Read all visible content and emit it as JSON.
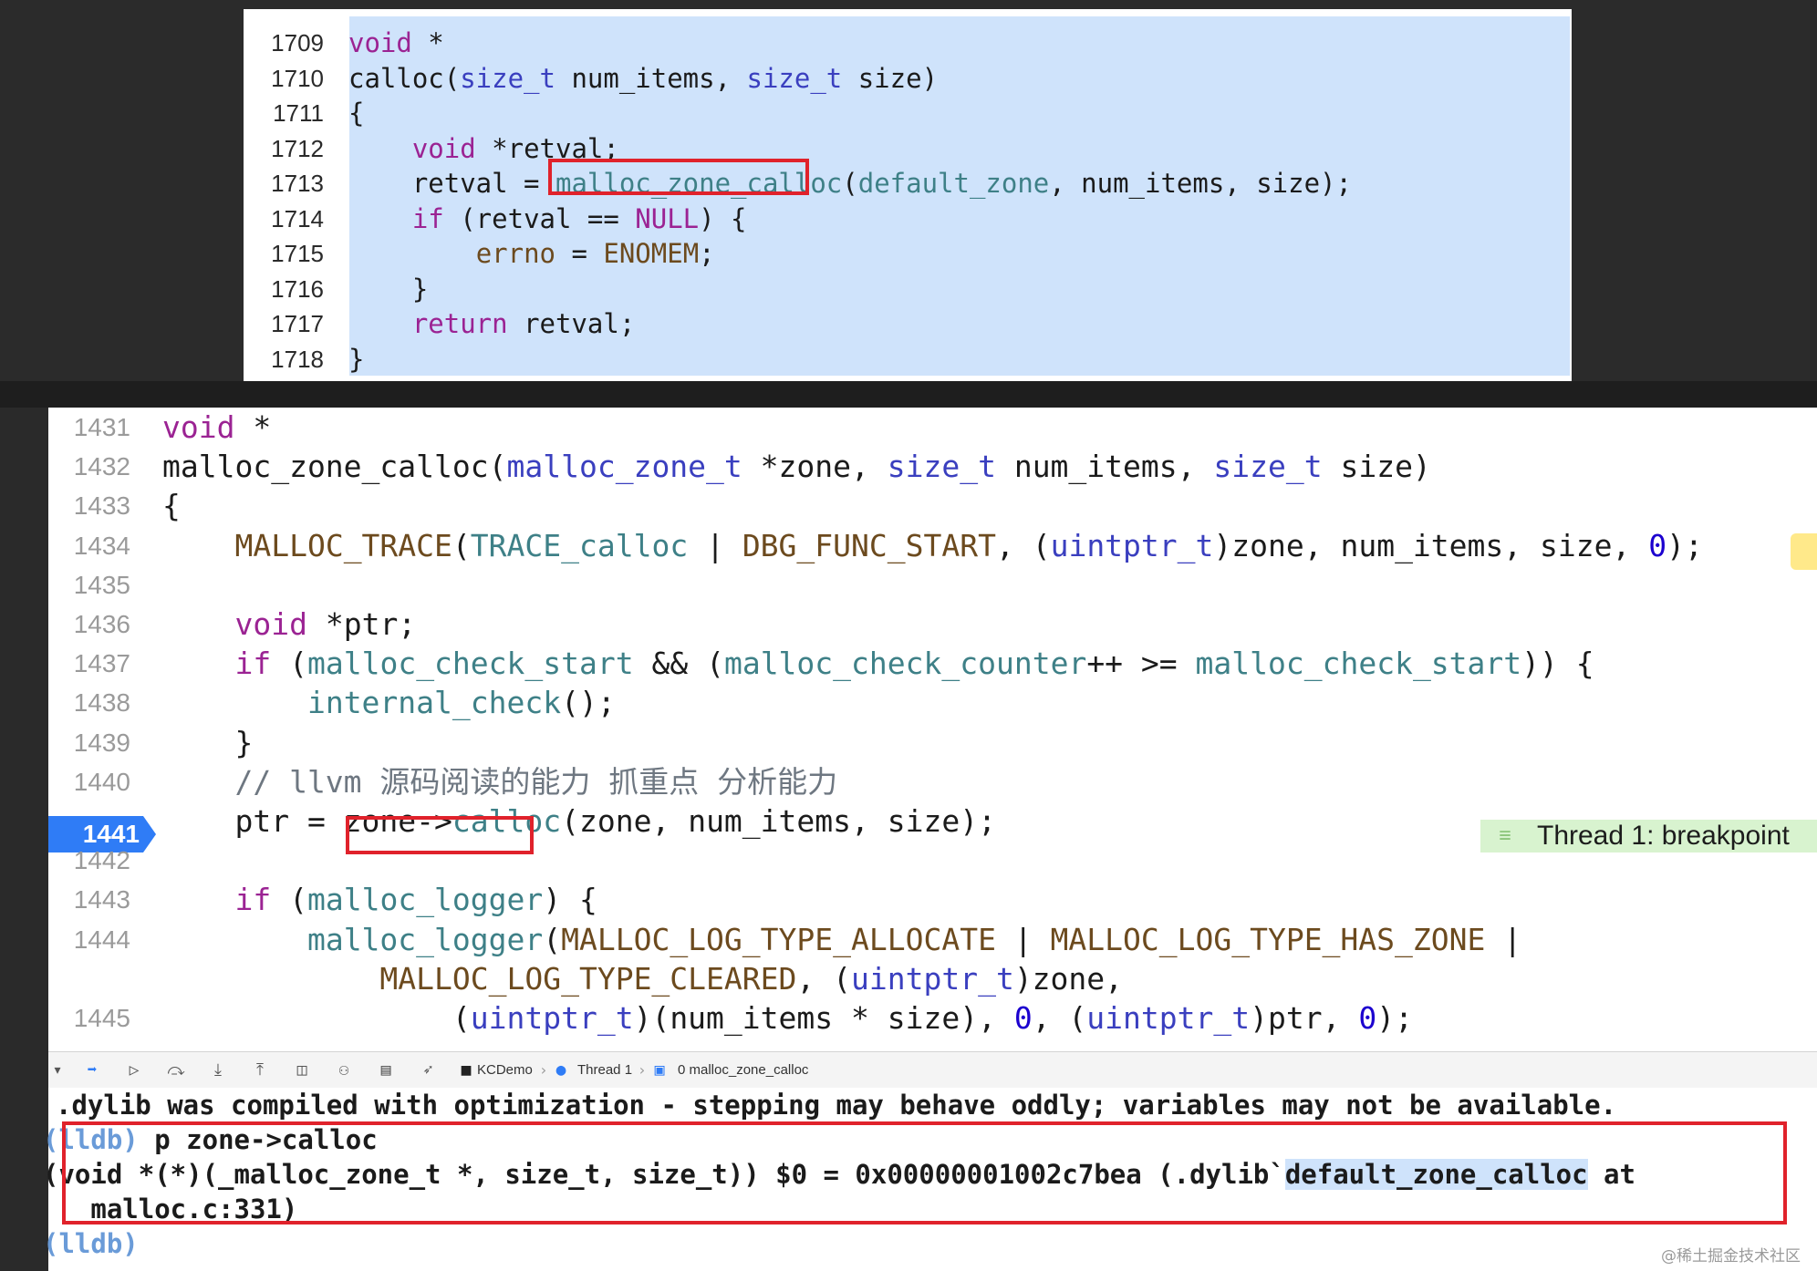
{
  "top_code": {
    "lines": [
      {
        "num": "1709",
        "segs": [
          {
            "t": "void",
            "c": "#9b2393"
          },
          {
            "t": " *",
            "c": "#1b1b1b"
          }
        ]
      },
      {
        "num": "1710",
        "segs": [
          {
            "t": "calloc(",
            "c": "#1b1b1b"
          },
          {
            "t": "size_t",
            "c": "#3a3fbf"
          },
          {
            "t": " num_items, ",
            "c": "#1b1b1b"
          },
          {
            "t": "size_t",
            "c": "#3a3fbf"
          },
          {
            "t": " size)",
            "c": "#1b1b1b"
          }
        ]
      },
      {
        "num": "1711",
        "segs": [
          {
            "t": "{",
            "c": "#1b1b1b"
          }
        ]
      },
      {
        "num": "1712",
        "segs": [
          {
            "t": "    ",
            "c": "#1b1b1b"
          },
          {
            "t": "void",
            "c": "#9b2393"
          },
          {
            "t": " *retval;",
            "c": "#1b1b1b"
          }
        ]
      },
      {
        "num": "1713",
        "segs": [
          {
            "t": "    retval = ",
            "c": "#1b1b1b"
          },
          {
            "t": "malloc_zone_calloc",
            "c": "#3e8087"
          },
          {
            "t": "(",
            "c": "#1b1b1b"
          },
          {
            "t": "default_zone",
            "c": "#3e8087"
          },
          {
            "t": ", num_items, size);",
            "c": "#1b1b1b"
          }
        ]
      },
      {
        "num": "1714",
        "segs": [
          {
            "t": "    ",
            "c": "#1b1b1b"
          },
          {
            "t": "if",
            "c": "#9b2393"
          },
          {
            "t": " (retval == ",
            "c": "#1b1b1b"
          },
          {
            "t": "NULL",
            "c": "#9b2393"
          },
          {
            "t": ") {",
            "c": "#1b1b1b"
          }
        ]
      },
      {
        "num": "1715",
        "segs": [
          {
            "t": "        ",
            "c": "#1b1b1b"
          },
          {
            "t": "errno",
            "c": "#6c4a1e"
          },
          {
            "t": " = ",
            "c": "#1b1b1b"
          },
          {
            "t": "ENOMEM",
            "c": "#6c4a1e"
          },
          {
            "t": ";",
            "c": "#1b1b1b"
          }
        ]
      },
      {
        "num": "1716",
        "segs": [
          {
            "t": "    }",
            "c": "#1b1b1b"
          }
        ]
      },
      {
        "num": "1717",
        "segs": [
          {
            "t": "    ",
            "c": "#1b1b1b"
          },
          {
            "t": "return",
            "c": "#9b2393"
          },
          {
            "t": " retval;",
            "c": "#1b1b1b"
          }
        ]
      },
      {
        "num": "1718",
        "segs": [
          {
            "t": "}",
            "c": "#1b1b1b"
          }
        ]
      }
    ]
  },
  "bottom_code": {
    "lines": [
      {
        "num": "1431",
        "segs": [
          {
            "t": "void",
            "c": "#9b2393"
          },
          {
            "t": " *",
            "c": "#1b1b1b"
          }
        ]
      },
      {
        "num": "1432",
        "segs": [
          {
            "t": "malloc_zone_calloc(",
            "c": "#1b1b1b"
          },
          {
            "t": "malloc_zone_t",
            "c": "#3a3fbf"
          },
          {
            "t": " *zone, ",
            "c": "#1b1b1b"
          },
          {
            "t": "size_t",
            "c": "#3a3fbf"
          },
          {
            "t": " num_items, ",
            "c": "#1b1b1b"
          },
          {
            "t": "size_t",
            "c": "#3a3fbf"
          },
          {
            "t": " size)",
            "c": "#1b1b1b"
          }
        ]
      },
      {
        "num": "1433",
        "segs": [
          {
            "t": "{",
            "c": "#1b1b1b"
          }
        ]
      },
      {
        "num": "1434",
        "segs": [
          {
            "t": "    ",
            "c": "#1b1b1b"
          },
          {
            "t": "MALLOC_TRACE",
            "c": "#6c4a1e"
          },
          {
            "t": "(",
            "c": "#1b1b1b"
          },
          {
            "t": "TRACE_calloc",
            "c": "#3e8087"
          },
          {
            "t": " | ",
            "c": "#1b1b1b"
          },
          {
            "t": "DBG_FUNC_START",
            "c": "#6c4a1e"
          },
          {
            "t": ", (",
            "c": "#1b1b1b"
          },
          {
            "t": "uintptr_t",
            "c": "#3a3fbf"
          },
          {
            "t": ")zone, num_items, size, ",
            "c": "#1b1b1b"
          },
          {
            "t": "0",
            "c": "#1c00cf"
          },
          {
            "t": ");",
            "c": "#1b1b1b"
          }
        ]
      },
      {
        "num": "1435",
        "segs": []
      },
      {
        "num": "1436",
        "segs": [
          {
            "t": "    ",
            "c": "#1b1b1b"
          },
          {
            "t": "void",
            "c": "#9b2393"
          },
          {
            "t": " *ptr;",
            "c": "#1b1b1b"
          }
        ]
      },
      {
        "num": "1437",
        "segs": [
          {
            "t": "    ",
            "c": "#1b1b1b"
          },
          {
            "t": "if",
            "c": "#9b2393"
          },
          {
            "t": " (",
            "c": "#1b1b1b"
          },
          {
            "t": "malloc_check_start",
            "c": "#3e8087"
          },
          {
            "t": " && (",
            "c": "#1b1b1b"
          },
          {
            "t": "malloc_check_counter",
            "c": "#3e8087"
          },
          {
            "t": "++ >= ",
            "c": "#1b1b1b"
          },
          {
            "t": "malloc_check_start",
            "c": "#3e8087"
          },
          {
            "t": ")) {",
            "c": "#1b1b1b"
          }
        ]
      },
      {
        "num": "1438",
        "segs": [
          {
            "t": "        ",
            "c": "#1b1b1b"
          },
          {
            "t": "internal_check",
            "c": "#3e8087"
          },
          {
            "t": "();",
            "c": "#1b1b1b"
          }
        ]
      },
      {
        "num": "1439",
        "segs": [
          {
            "t": "    }",
            "c": "#1b1b1b"
          }
        ]
      },
      {
        "num": "1440",
        "segs": [
          {
            "t": "    // llvm 源码阅读的能力 抓重点 分析能力",
            "c": "#6e7781"
          }
        ]
      },
      {
        "num": "1441",
        "segs": [
          {
            "t": "    ptr = ",
            "c": "#1b1b1b"
          },
          {
            "t": "zone->",
            "c": "#1b1b1b"
          },
          {
            "t": "calloc",
            "c": "#3e8087"
          },
          {
            "t": "(zone, num_items, size);",
            "c": "#1b1b1b"
          }
        ]
      },
      {
        "num": "1442",
        "segs": []
      },
      {
        "num": "1443",
        "segs": [
          {
            "t": "    ",
            "c": "#1b1b1b"
          },
          {
            "t": "if",
            "c": "#9b2393"
          },
          {
            "t": " (",
            "c": "#1b1b1b"
          },
          {
            "t": "malloc_logger",
            "c": "#3e8087"
          },
          {
            "t": ") {",
            "c": "#1b1b1b"
          }
        ]
      },
      {
        "num": "1444",
        "segs": [
          {
            "t": "        ",
            "c": "#1b1b1b"
          },
          {
            "t": "malloc_logger",
            "c": "#3e8087"
          },
          {
            "t": "(",
            "c": "#1b1b1b"
          },
          {
            "t": "MALLOC_LOG_TYPE_ALLOCATE",
            "c": "#6c4a1e"
          },
          {
            "t": " | ",
            "c": "#1b1b1b"
          },
          {
            "t": "MALLOC_LOG_TYPE_HAS_ZONE",
            "c": "#6c4a1e"
          },
          {
            "t": " |",
            "c": "#1b1b1b"
          }
        ]
      },
      {
        "num": "",
        "segs": [
          {
            "t": "            ",
            "c": "#1b1b1b"
          },
          {
            "t": "MALLOC_LOG_TYPE_CLEARED",
            "c": "#6c4a1e"
          },
          {
            "t": ", (",
            "c": "#1b1b1b"
          },
          {
            "t": "uintptr_t",
            "c": "#3a3fbf"
          },
          {
            "t": ")zone,",
            "c": "#1b1b1b"
          }
        ]
      },
      {
        "num": "1445",
        "segs": [
          {
            "t": "                (",
            "c": "#1b1b1b"
          },
          {
            "t": "uintptr_t",
            "c": "#3a3fbf"
          },
          {
            "t": ")(num_items * size), ",
            "c": "#1b1b1b"
          },
          {
            "t": "0",
            "c": "#1c00cf"
          },
          {
            "t": ", (",
            "c": "#1b1b1b"
          },
          {
            "t": "uintptr_t",
            "c": "#3a3fbf"
          },
          {
            "t": ")ptr, ",
            "c": "#1b1b1b"
          },
          {
            "t": "0",
            "c": "#1c00cf"
          },
          {
            "t": ");",
            "c": "#1b1b1b"
          }
        ]
      }
    ],
    "breakpoint_line": "1441",
    "thread_banner": "Thread 1: breakpoint"
  },
  "debug_bar": {
    "crumbs": [
      "KCDemo",
      "Thread 1",
      "0 malloc_zone_calloc"
    ],
    "icons": [
      "hide-console-icon",
      "breakpoints-toggle-icon",
      "continue-icon",
      "step-over-icon",
      "step-into-icon",
      "step-out-icon",
      "view-hierarchy-icon",
      "memory-graph-icon",
      "environment-icon",
      "location-icon"
    ]
  },
  "console": {
    "line1": ".dylib was compiled with optimization - stepping may behave oddly; variables may not be available.",
    "line2_prompt": "(lldb)",
    "line2_cmd": " p zone->calloc",
    "line3_a": "(void *(*)(_malloc_zone_t *, size_t, size_t)) $0 = 0x00000001002c7bea (.dylib`",
    "line3_hl": "default_zone_calloc",
    "line3_b": " at",
    "line4": "   malloc.c:331)",
    "line5_prompt": "(lldb)"
  },
  "watermark": "@稀土掘金技术社区",
  "colors": {
    "keyword": "#9b2393",
    "type": "#3a3fbf",
    "function": "#3e8087",
    "macro": "#6c4a1e",
    "annotation_red": "#e0222b",
    "selection_blue": "#cfe3fb",
    "breakpoint_blue": "#2f7cf6",
    "thread_green": "#d8f3cf"
  }
}
